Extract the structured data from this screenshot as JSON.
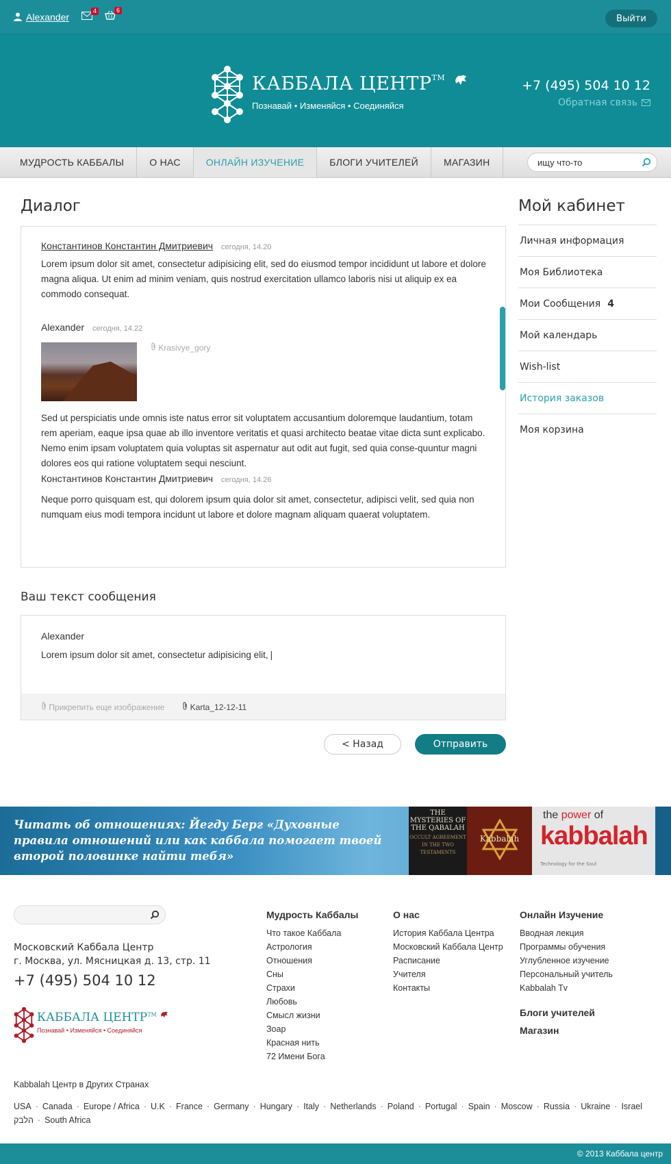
{
  "topbar": {
    "username": "Alexander",
    "mail_count": "4",
    "cart_count": "6",
    "logout_label": "Выйти"
  },
  "header": {
    "brand": "КАББАЛА ЦЕНТР",
    "tm": "TM",
    "tagline": "Познавай • Изменяйся • Соединяйся",
    "phone": "+7 (495) 504 10 12",
    "feedback": "Обратная связь"
  },
  "nav": {
    "items": [
      "МУДРОСТЬ КАББАЛЫ",
      "О НАС",
      "ОНЛАЙН ИЗУЧЕНИЕ",
      "БЛОГИ УЧИТЕЛЕЙ",
      "МАГАЗИН"
    ],
    "search_value": "ищу что-то"
  },
  "dialog": {
    "title": "Диалог",
    "messages": [
      {
        "author": "Константинов Константин Дмитриевич",
        "time": "сегодня, 14.20",
        "text": "Lorem ipsum dolor sit amet, consectetur adipisicing elit, sed do eiusmod tempor incididunt ut labore et dolore magna aliqua. Ut enim ad minim veniam, quis nostrud exercitation ullamco laboris nisi ut aliquip ex ea commodo consequat."
      },
      {
        "author": "Alexander",
        "time": "сегодня, 14.22",
        "attachment": "Krasivye_gory",
        "text": "Sed ut perspiciatis unde omnis iste natus error sit voluptatem accusantium doloremque laudantium, totam rem aperiam, eaque ipsa quae ab illo inventore veritatis et quasi architecto beatae vitae dicta sunt explicabo. Nemo enim ipsam voluptatem quia voluptas sit aspernatur aut odit aut fugit, sed quia conse-quuntur magni dolores eos qui ratione voluptatem sequi nesciunt."
      },
      {
        "author": "Константинов Константин Дмитриевич",
        "time": "сегодня, 14.26",
        "text": "Neque porro quisquam est, qui dolorem ipsum quia dolor sit amet, consectetur, adipisci velit, sed quia non numquam eius modi tempora incidunt ut labore et dolore magnam aliquam quaerat voluptatem."
      }
    ]
  },
  "compose": {
    "title": "Ваш текст сообщения",
    "author": "Alexander",
    "text": "Lorem ipsum dolor sit amet, consectetur adipisicing elit,",
    "attach_label": "Прикрепить еще изображение",
    "file": "Karta_12-12-11",
    "back_label": "< Назад",
    "send_label": "Отправить"
  },
  "sidebar": {
    "title": "Мой кабинет",
    "items": [
      {
        "label": "Личная информация"
      },
      {
        "label": "Моя Библиотека"
      },
      {
        "label": "Мои Сообщения",
        "count": "4"
      },
      {
        "label": "Мой календарь"
      },
      {
        "label": "Wish-list"
      },
      {
        "label": "История заказов"
      },
      {
        "label": "Моя корзина"
      }
    ]
  },
  "banner": {
    "text": "Читать об отношениях: Йегду Берг «Духовные правила отношений или как каббала помогает твоей второй половинке найти тебя»",
    "book1_title": "THE MYSTERIES OF THE QABALAH",
    "book1_sub": "OCCULT AGREEMENT IN THE TWO TESTAMENTS",
    "book2_title": "Kabbalah",
    "book3_a": "the",
    "book3_power": "power",
    "book3_of": "of",
    "book3_b": "kabbalah",
    "book3_c": "Technology for the Soul"
  },
  "footer": {
    "address_line1": "Московский Каббала Центр",
    "address_line2": "г. Москва, ул. Мясницкая д. 13, стр. 11",
    "phone": "+7 (495) 504 10 12",
    "logo_text": "КАББАЛА ЦЕНТР",
    "logo_tm": "TM",
    "logo_sub": "Познавай • Изменяйся • Соединяйся",
    "col1": {
      "title": "Мудрость Каббалы",
      "links": [
        "Что такое Каббала",
        "Астрология",
        "Отношения",
        "Сны",
        "Страхи",
        "Любовь",
        "Смысл жизни",
        "Зоар",
        "Красная нить",
        "72 Имени Бога"
      ]
    },
    "col2": {
      "title": "О нас",
      "links": [
        "История Каббала Центра",
        "Московский Каббала Центр",
        "Расписание",
        "Учителя",
        "Контакты"
      ]
    },
    "col3": {
      "title": "Онлайн Изучение",
      "links": [
        "Вводная лекция",
        "Программы обучения",
        "Углубленное изучение",
        "Персональный учитель",
        "Kabbalah Tv"
      ],
      "extra1": "Блоги учителей",
      "extra2": "Магазин"
    },
    "countries_title": "Kabbalah Центр в Других Странах",
    "countries": [
      "USA",
      "Canada",
      "Europe / Africa",
      "U.K",
      "France",
      "Germany",
      "Hungary",
      "Italy",
      "Netherlands",
      "Poland",
      "Portugal",
      "Spain",
      "Moscow",
      "Russia",
      "Ukraine",
      "Israel הלבק",
      "South Africa"
    ],
    "copyright": "© 2013 Каббала центр"
  },
  "colors": {
    "brand_teal": "#0f8c95",
    "accent": "#2aa0ac",
    "badge_red": "#c8102e"
  }
}
